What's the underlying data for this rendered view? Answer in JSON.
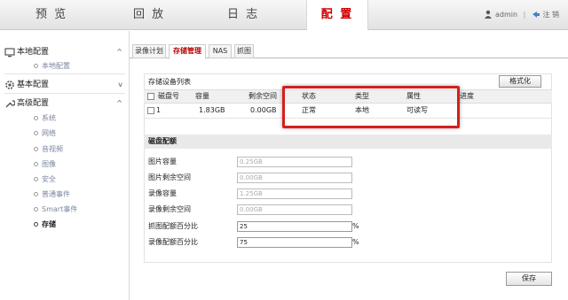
{
  "topnav": {
    "tabs": [
      {
        "label": "预 览"
      },
      {
        "label": "回 放"
      },
      {
        "label": "日 志"
      },
      {
        "label": "配 置"
      }
    ],
    "user": "admin",
    "separator": "|",
    "logout": "注 销"
  },
  "sidebar": {
    "local": {
      "label": "本地配置",
      "items": [
        {
          "label": "本地配置"
        }
      ]
    },
    "basic": {
      "label": "基本配置"
    },
    "advanced": {
      "label": "高级配置",
      "items": [
        {
          "label": "系统"
        },
        {
          "label": "网络"
        },
        {
          "label": "音视频"
        },
        {
          "label": "图像"
        },
        {
          "label": "安全"
        },
        {
          "label": "普通事件"
        },
        {
          "label": "Smart事件"
        },
        {
          "label": "存储"
        }
      ]
    }
  },
  "subtabs": [
    {
      "label": "录像计划"
    },
    {
      "label": "存储管理"
    },
    {
      "label": "NAS"
    },
    {
      "label": "抓图"
    }
  ],
  "storage_list": {
    "title": "存储设备列表",
    "format_button": "格式化",
    "columns": [
      "磁盘号",
      "容量",
      "剩余空间",
      "状态",
      "类型",
      "属性",
      "进度"
    ],
    "rows": [
      {
        "disk": "1",
        "capacity": "1.83GB",
        "free": "0.00GB",
        "status": "正常",
        "type": "本地",
        "attr": "可读写",
        "progress": ""
      }
    ]
  },
  "quota": {
    "title": "磁盘配额",
    "fields": [
      {
        "label": "图片容量",
        "value": "0.25GB"
      },
      {
        "label": "图片剩余空间",
        "value": "0.00GB"
      },
      {
        "label": "录像容量",
        "value": "1.25GB"
      },
      {
        "label": "录像剩余空间",
        "value": "0.00GB"
      },
      {
        "label": "抓图配额百分比",
        "value": "25",
        "unit": "%"
      },
      {
        "label": "录像配额百分比",
        "value": "75",
        "unit": "%"
      }
    ]
  },
  "save_button": "保存",
  "colors": {
    "accent": "#cc0000",
    "highlight_box": "#d41f1f"
  }
}
